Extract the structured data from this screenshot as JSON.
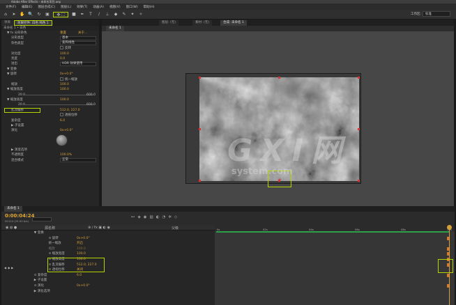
{
  "app": {
    "title": "Adobe After Effects - 未命名项目.aep"
  },
  "menu": [
    "文件(F)",
    "编辑(E)",
    "图层合成(C)",
    "图层(L)",
    "效果(T)",
    "动画(A)",
    "视图(V)",
    "窗口(W)",
    "帮助(H)"
  ],
  "toolbar": {
    "workspace_label": "工作区:",
    "workspace_value": "标准"
  },
  "left_panel": {
    "tabs": [
      "项目",
      "效果控件: 白色 纯色 1"
    ],
    "breadcrumb": "未命名 1 • 白色",
    "props": [
      {
        "label": "▼ fx  分形杂色",
        "value": "重置",
        "extra": "关于..."
      },
      {
        "label": "分形类型",
        "dropdown": "基本"
      },
      {
        "label": "杂色类型",
        "dropdown": "柔和线性"
      },
      {
        "label": "",
        "check": "反转"
      },
      {
        "label": "对比度",
        "value": "100.0"
      },
      {
        "label": "亮度",
        "value": "0.0"
      },
      {
        "label": "溢出",
        "dropdown": "HDR 效果使用"
      },
      {
        "label": "▼ 变换",
        "value": ""
      },
      {
        "label": "▼ 旋转",
        "value": "0x+0.0°"
      },
      {
        "label": "",
        "check": "统一缩放"
      },
      {
        "label": "缩放",
        "value": "100.0"
      },
      {
        "label": "▼ 缩放宽度",
        "value": "100.0"
      },
      {
        "label": "20.0",
        "slider": "600.0"
      },
      {
        "label": "▼ 缩放高度",
        "value": "100.0"
      },
      {
        "label": "20.0",
        "slider": "600.0"
      },
      {
        "label": "乱流偏移",
        "value": "512.0, 227.0"
      },
      {
        "label": "",
        "check": "透视位移"
      },
      {
        "label": "复杂度",
        "value": "6.0"
      },
      {
        "label": "▶ 子设置",
        "value": ""
      },
      {
        "label": "演化",
        "value": "0x+0.0°"
      }
    ],
    "props2": [
      {
        "label": "▶ 演变选项",
        "value": ""
      },
      {
        "label": "不透明度",
        "value": "100.0%"
      },
      {
        "label": "混合模式",
        "dropdown": "正常"
      }
    ]
  },
  "comp_panel": {
    "tabs": [
      "图层: (无)",
      "素材: (无)",
      "合成: 未命名 1"
    ],
    "subtab": "未命名 1",
    "footer": [
      "50 %",
      "0:00:04:24",
      "(1/2)",
      "活动摄像机",
      "1 个视图",
      "+0.0"
    ]
  },
  "watermark": {
    "big": "G X I 网",
    "small": "system.com"
  },
  "timeline": {
    "tab": "未命名 1",
    "timecode": "0:00:04:24",
    "fps": "00124 (25.00 fps)",
    "col_label": "源名称",
    "col_mode": "父级",
    "ticks": [
      "0s",
      "02s",
      "04s",
      "06s",
      "08s",
      "10s"
    ],
    "rows": [
      {
        "label": "▼ 变换",
        "value": "",
        "indent": 18
      },
      {
        "label": "⊙ 旋转",
        "value": "0x+0.0°",
        "indent": 26
      },
      {
        "label": "统一缩放",
        "value": "开启",
        "indent": 26
      },
      {
        "label": "缩放",
        "value": "100.0",
        "indent": 26,
        "dim": true
      },
      {
        "label": "⊙ 缩放宽度",
        "value": "100.0",
        "indent": 26
      },
      {
        "label": "⊙ 缩放高度",
        "value": "100.0",
        "indent": 26
      },
      {
        "label": "⊙ 乱流偏移",
        "value": "512.0, 227.0",
        "indent": 26,
        "highlight": true
      },
      {
        "label": "⊙ 透视位移",
        "value": "关闭",
        "indent": 26
      },
      {
        "label": "⊙ 复杂度",
        "value": "6.0",
        "indent": 18
      },
      {
        "label": "▶ 子设置",
        "value": "",
        "indent": 18
      },
      {
        "label": "⊙ 演化",
        "value": "0x+0.0°",
        "indent": 18
      },
      {
        "label": "▶ 演化选项",
        "value": "",
        "indent": 18
      }
    ]
  },
  "colors": {
    "accent_value": "#d7a03a",
    "highlight": "#b8d400",
    "keyframe": "#d67a2a"
  }
}
